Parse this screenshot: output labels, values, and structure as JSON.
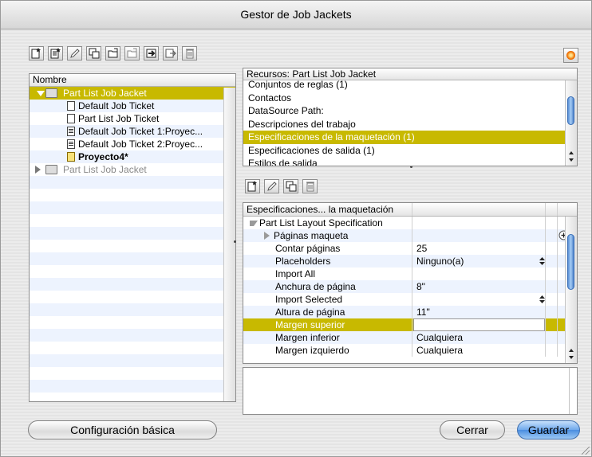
{
  "window": {
    "title": "Gestor de Job Jackets"
  },
  "left_toolbar": {
    "icons": [
      "new-job-jacket-icon",
      "new-job-ticket-icon",
      "edit-icon",
      "duplicate-icon",
      "open-icon",
      "open-linked-icon",
      "import-icon",
      "export-icon",
      "trash-icon"
    ]
  },
  "right_toolbar": {
    "icons": [
      "new-icon",
      "edit-icon",
      "duplicate-icon",
      "trash-icon"
    ]
  },
  "tree": {
    "header": "Nombre",
    "items": [
      {
        "label": "Part List Job Jacket",
        "level": 0,
        "selected": true,
        "expanded": true,
        "icon": "job-jacket-icon"
      },
      {
        "label": "Default Job Ticket",
        "level": 1,
        "icon": "ticket-icon"
      },
      {
        "label": "Part List Job Ticket",
        "level": 1,
        "icon": "ticket-icon"
      },
      {
        "label": "Default Job Ticket 1:Proyec...",
        "level": 1,
        "icon": "ticket-lined-icon"
      },
      {
        "label": "Default Job Ticket 2:Proyec...",
        "level": 1,
        "icon": "ticket-lined-icon"
      },
      {
        "label": "Proyecto4*",
        "level": 1,
        "icon": "project-icon",
        "bold": true
      },
      {
        "label": "Part List Job Jacket",
        "level": 0,
        "expanded": false,
        "icon": "job-jacket-icon",
        "dim": true
      }
    ]
  },
  "resources": {
    "header": "Recursos: Part List Job Jacket",
    "items": [
      "Conjuntos de reglas (1)",
      "Contactos",
      "DataSource Path:",
      "Descripciones del trabajo",
      "Especificaciones de la maquetación (1)",
      "Especificaciones de salida (1)",
      "Estilos de salida"
    ],
    "selected_index": 4
  },
  "specs": {
    "col1_header": "Especificaciones... la maquetación",
    "col2_header": "",
    "rows": [
      {
        "label": "Part List Layout Specification",
        "value": "",
        "indent": 0,
        "arrow": "down"
      },
      {
        "label": "Páginas maqueta",
        "value": "",
        "indent": 1,
        "arrow": "right",
        "add": true
      },
      {
        "label": "Contar páginas",
        "value": "25",
        "indent": 2
      },
      {
        "label": "Placeholders",
        "value": "Ninguno(a)",
        "indent": 2,
        "stepper": true
      },
      {
        "label": "Import All",
        "value": "",
        "indent": 2
      },
      {
        "label": "Anchura de página",
        "value": "8\"",
        "indent": 2
      },
      {
        "label": "Import Selected",
        "value": "",
        "indent": 2,
        "stepper": true
      },
      {
        "label": "Altura de página",
        "value": "11\"",
        "indent": 2
      },
      {
        "label": "Margen superior",
        "value": "",
        "indent": 2,
        "selected": true,
        "editing": true
      },
      {
        "label": "Margen inferior",
        "value": "Cualquiera",
        "indent": 2
      },
      {
        "label": "Margen izquierdo",
        "value": "Cualquiera",
        "indent": 2
      }
    ]
  },
  "buttons": {
    "basic_config": "Configuración básica",
    "close": "Cerrar",
    "save": "Guardar"
  },
  "colors": {
    "selection": "#c8b900",
    "alt_row": "#edf3fe",
    "default_button": "#4a8de0"
  }
}
